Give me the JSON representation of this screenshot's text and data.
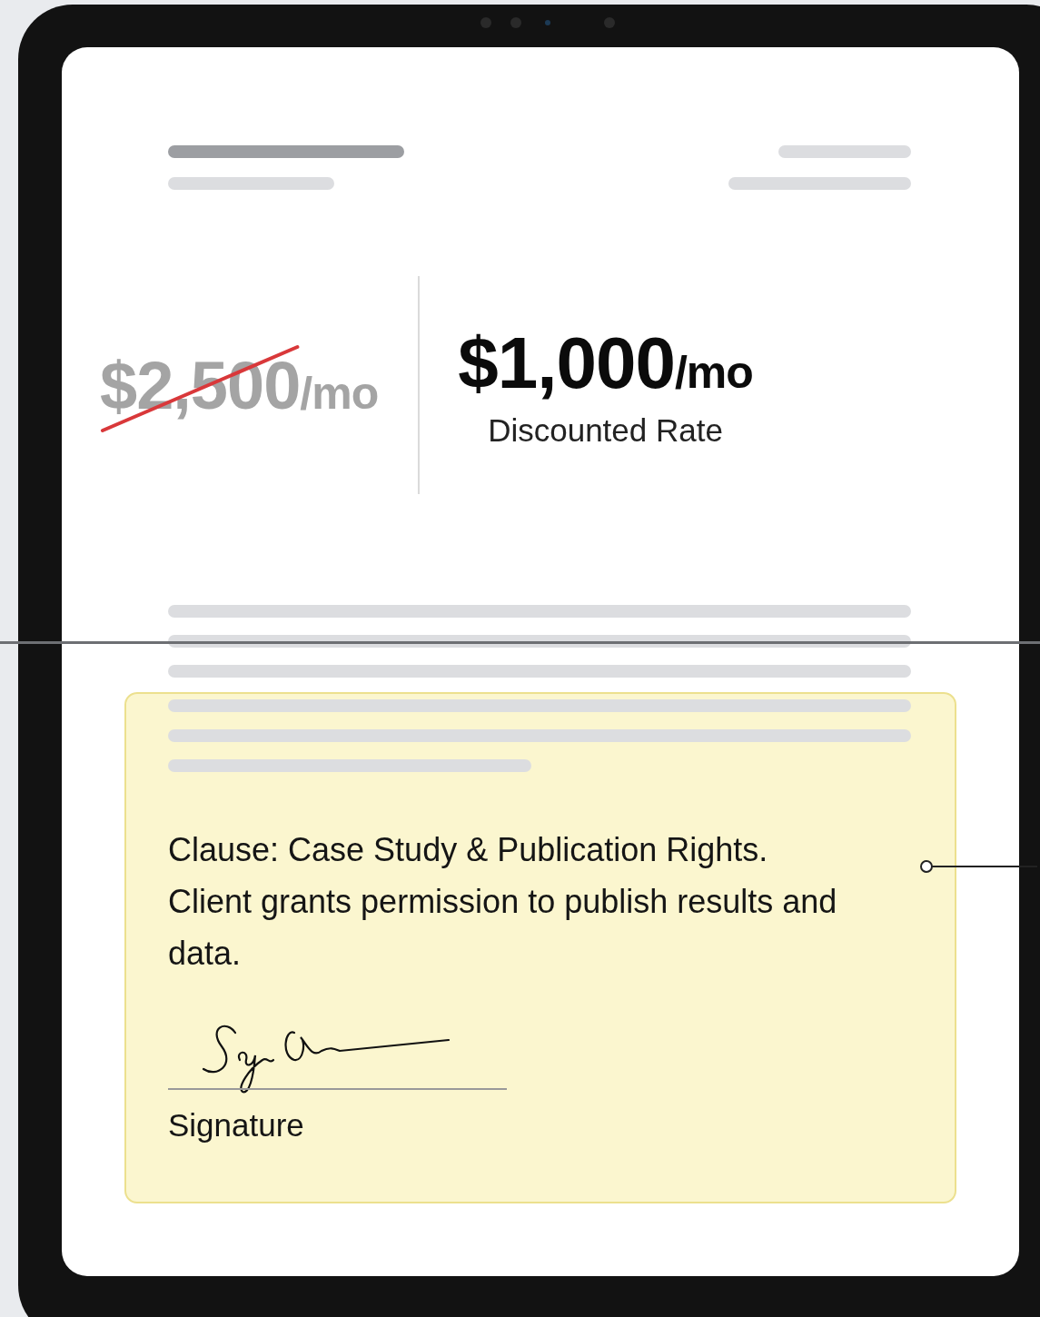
{
  "document": {
    "original_price": {
      "amount": "$2,500",
      "unit": "/mo",
      "struck": true
    },
    "discounted_price": {
      "amount": "$1,000",
      "unit": "/mo"
    },
    "discount_label": "Discounted Rate",
    "clause": {
      "text": "Clause: Case Study & Publication Rights. Client grants permission to publish results and data.",
      "highlighted": true
    },
    "signature_label": "Signature"
  }
}
